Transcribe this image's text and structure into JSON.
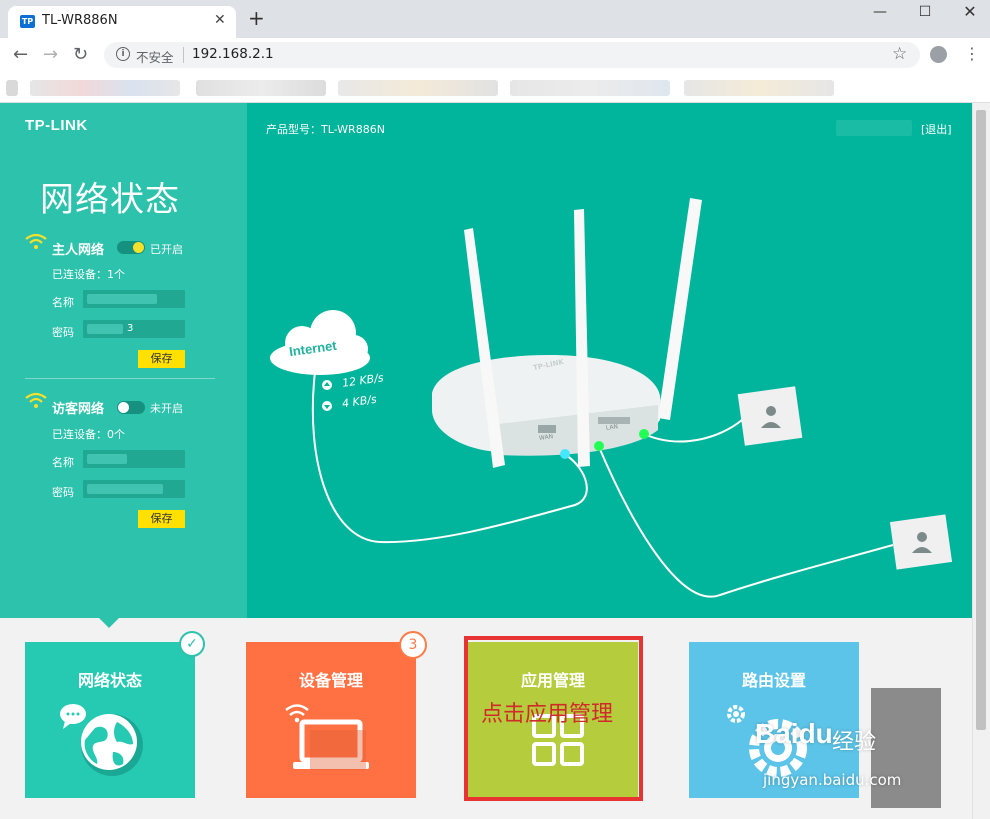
{
  "browser": {
    "tab_title": "TL-WR886N",
    "favicon_text": "TP",
    "new_tab": "+",
    "security_label": "不安全",
    "url": "192.168.2.1"
  },
  "app": {
    "logo": "TP-LINK",
    "model_label": "产品型号：TL-WR886N",
    "logout": "[退出]",
    "accent": "#00b59b"
  },
  "sidebar": {
    "title": "网络状态",
    "host": {
      "title": "主人网络",
      "toggle_state": "已开启",
      "connected": "已连设备：1个",
      "name_label": "名称",
      "password_label": "密码",
      "password_value_tail": "3",
      "save": "保存"
    },
    "guest": {
      "title": "访客网络",
      "toggle_state": "未开启",
      "connected": "已连设备：0个",
      "name_label": "名称",
      "password_label": "密码",
      "save": "保存"
    }
  },
  "diagram": {
    "internet": "Internet",
    "upload": "12 KB/s",
    "download": "4 KB/s",
    "router_brand": "TP-LINK",
    "wan_label": "WAN",
    "lan_label": "LAN"
  },
  "cards": [
    {
      "label": "网络状态",
      "color": "#26c9b2"
    },
    {
      "label": "设备管理",
      "color": "#ff7043",
      "badge": "3"
    },
    {
      "label": "应用管理",
      "color": "#b5cc3d"
    },
    {
      "label": "路由设置",
      "color": "#5cc4e8"
    }
  ],
  "annotation": "点击应用管理",
  "watermark": {
    "logo": "Baidu",
    "sub": "经验",
    "url": "jingyan.baidu.com"
  }
}
